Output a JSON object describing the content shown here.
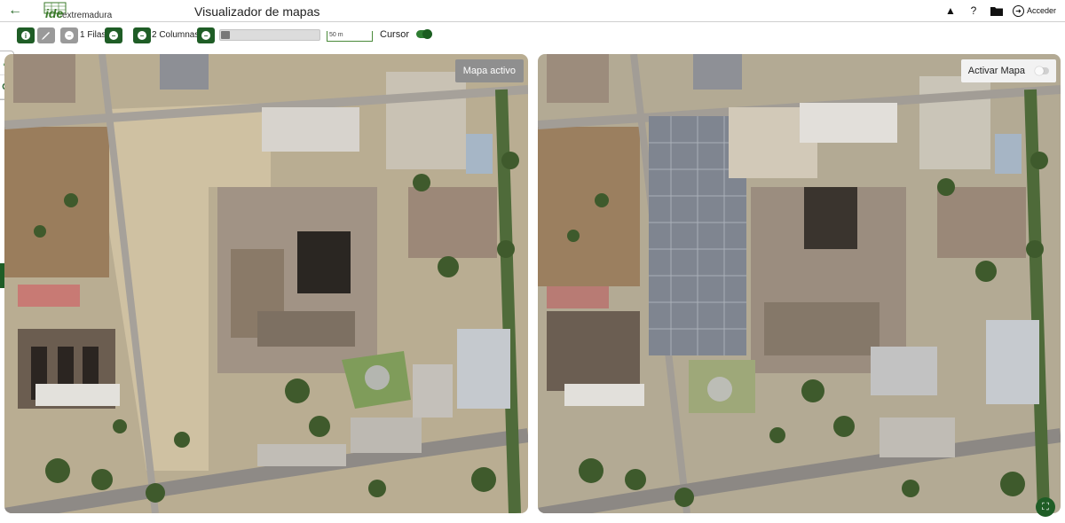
{
  "header": {
    "title": "Visualizador de mapas",
    "logo_text": "extremadura",
    "logo_mark": "ide",
    "login_label": "Acceder"
  },
  "toolbar": {
    "rows_label": "1 Filas",
    "cols_label": "2 Columnas",
    "scale_text": "50 m",
    "cursor_label": "Cursor",
    "cursor_enabled": true
  },
  "maps": {
    "left": {
      "badge": "Mapa activo"
    },
    "right": {
      "activate_label": "Activar Mapa",
      "activated": false
    }
  },
  "colors": {
    "primary": "#1f5d26",
    "accent": "#2e7d32",
    "grey_button": "#9a9a9a"
  },
  "icons": {
    "back": "arrow-left-icon",
    "alert": "warning-icon",
    "help": "question-icon",
    "folder": "folder-icon",
    "login": "login-icon",
    "info": "info-icon",
    "layers": "layers-icon",
    "search": "search-icon",
    "fullscreen": "fullscreen-icon"
  }
}
